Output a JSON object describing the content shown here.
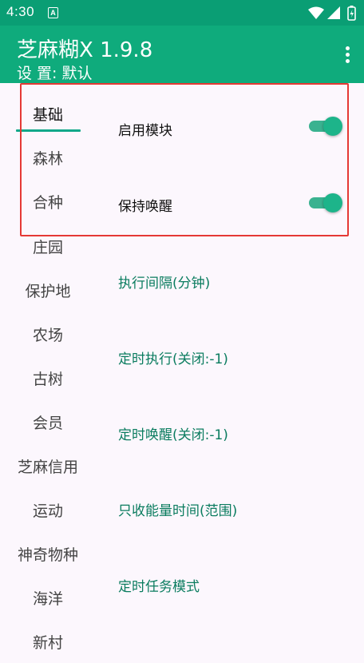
{
  "status_bar": {
    "time": "4:30",
    "notification_glyph": "A"
  },
  "app_bar": {
    "title": "芝麻糊X 1.9.8",
    "subtitle": "设 置: 默认",
    "menu_icon": "more-vert-icon"
  },
  "nav": {
    "items": [
      "基础",
      "森林",
      "合种",
      "庄园",
      "保护地",
      "农场",
      "古树",
      "会员",
      "芝麻信用",
      "运动",
      "神奇物种",
      "海洋",
      "新村"
    ],
    "active_index": 0
  },
  "settings": [
    {
      "label": "启用模块",
      "switch_on": true
    },
    {
      "label": "保持唤醒",
      "switch_on": true
    },
    {
      "label": "执行间隔(分钟)"
    },
    {
      "label": "定时执行(关闭:-1)"
    },
    {
      "label": "定时唤醒(关闭:-1)"
    },
    {
      "label": "只收能量时间(范围)"
    },
    {
      "label": "定时任务模式"
    }
  ],
  "colors": {
    "accent": "#0fab7c",
    "status_bar": "#0a9e74",
    "highlight_box": "#e53935",
    "setting_link": "#0a7c5f"
  }
}
